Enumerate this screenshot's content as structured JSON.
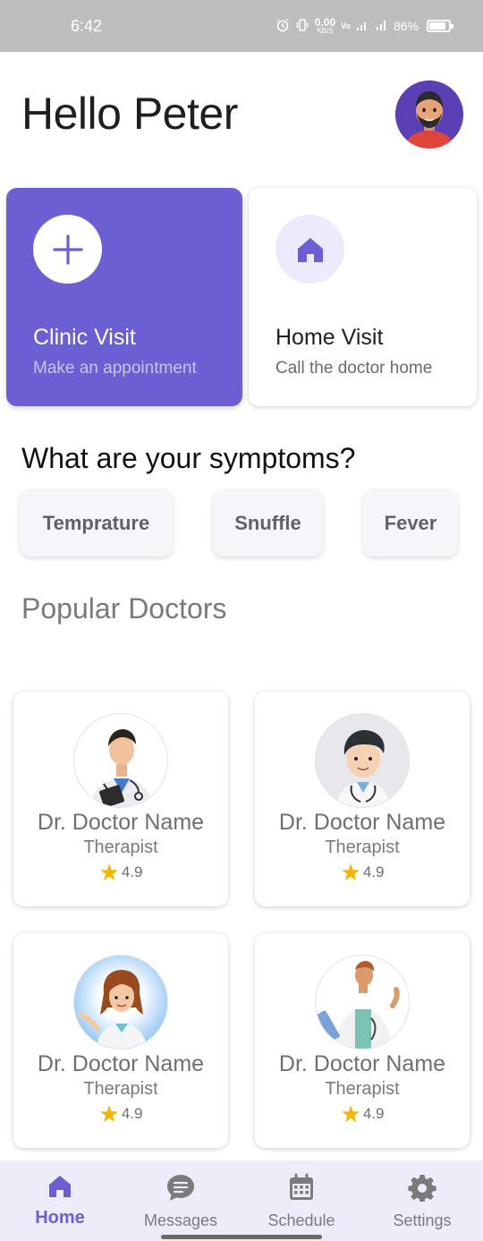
{
  "status_bar": {
    "time": "6:42",
    "net_speed": "0.00",
    "net_unit": "KB/S",
    "battery": "86%",
    "battery_level": 0.86
  },
  "header": {
    "greeting": "Hello Peter"
  },
  "visit_cards": [
    {
      "title": "Clinic Visit",
      "subtitle": "Make an appointment",
      "icon": "plus-icon"
    },
    {
      "title": "Home Visit",
      "subtitle": "Call the doctor home",
      "icon": "house-icon"
    }
  ],
  "symptoms": {
    "title": "What are your symptoms?",
    "chips": [
      "Temprature",
      "Snuffle",
      "Fever"
    ]
  },
  "popular": {
    "title": "Popular Doctors",
    "doctors": [
      {
        "name": "Dr. Doctor Name",
        "specialty": "Therapist",
        "rating": "4.9"
      },
      {
        "name": "Dr. Doctor Name",
        "specialty": "Therapist",
        "rating": "4.9"
      },
      {
        "name": "Dr. Doctor Name",
        "specialty": "Therapist",
        "rating": "4.9"
      },
      {
        "name": "Dr. Doctor Name",
        "specialty": "Therapist",
        "rating": "4.9"
      }
    ]
  },
  "nav": {
    "items": [
      {
        "label": "Home",
        "icon": "home-icon",
        "active": true
      },
      {
        "label": "Messages",
        "icon": "chat-icon",
        "active": false
      },
      {
        "label": "Schedule",
        "icon": "calendar-icon",
        "active": false
      },
      {
        "label": "Settings",
        "icon": "gear-icon",
        "active": false
      }
    ]
  },
  "colors": {
    "accent": "#6b5fd3",
    "accent_light": "#edeafb",
    "nav_bg": "#eeecf8",
    "star": "#f5b400"
  }
}
